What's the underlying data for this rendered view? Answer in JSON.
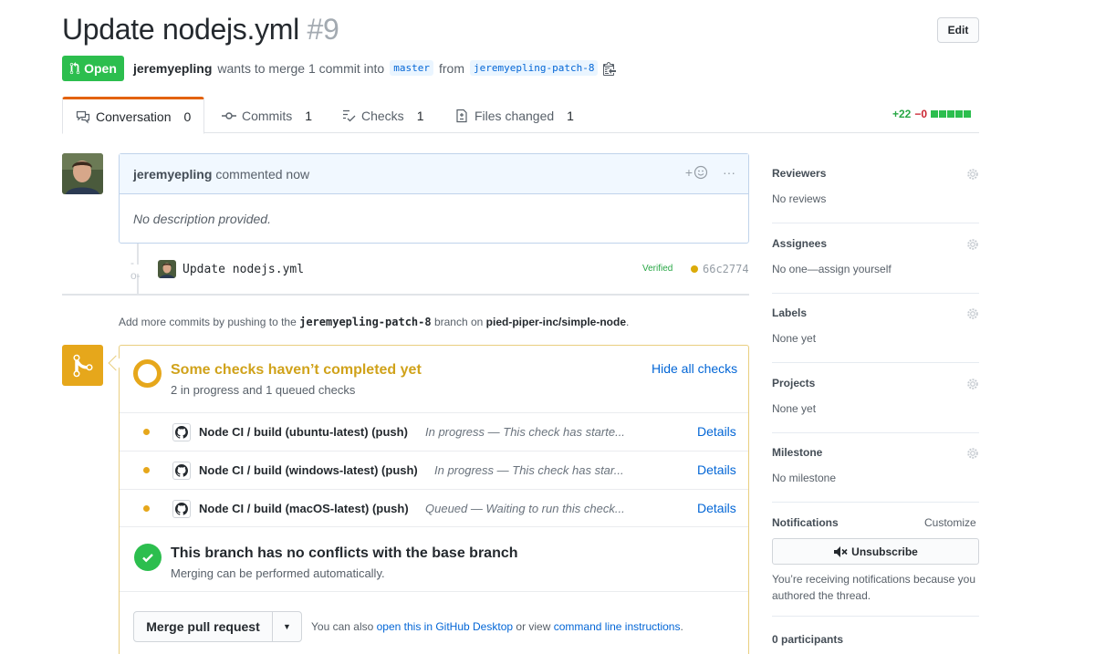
{
  "header": {
    "title": "Update nodejs.yml",
    "number": "#9",
    "edit_label": "Edit",
    "state": "Open",
    "author": "jeremyepling",
    "merge_text": "wants to merge 1 commit into",
    "base_branch": "master",
    "from_text": "from",
    "head_branch": "jeremyepling-patch-8"
  },
  "tabs": [
    {
      "label": "Conversation",
      "count": "0",
      "icon": "comment-discussion-icon"
    },
    {
      "label": "Commits",
      "count": "1",
      "icon": "git-commit-icon"
    },
    {
      "label": "Checks",
      "count": "1",
      "icon": "checklist-icon"
    },
    {
      "label": "Files changed",
      "count": "1",
      "icon": "file-diff-icon"
    }
  ],
  "diffstat": {
    "additions": "+22",
    "deletions": "−0"
  },
  "comment": {
    "author": "jeremyepling",
    "action": "commented now",
    "body": "No description provided.",
    "add_reaction": "+",
    "more": "···"
  },
  "commit": {
    "message": "Update nodejs.yml",
    "verified": "Verified",
    "sha": "66c2774"
  },
  "push_hint": {
    "prefix": "Add more commits by pushing to the",
    "branch": "jeremyepling-patch-8",
    "middle": "branch on",
    "repo": "pied-piper-inc/simple-node",
    "suffix": "."
  },
  "checks": {
    "title": "Some checks haven’t completed yet",
    "subtitle": "2 in progress and 1 queued checks",
    "hide_label": "Hide all checks",
    "status_color": "#e6a71b",
    "items": [
      {
        "name": "Node CI / build (ubuntu-latest) (push)",
        "desc": "In progress — This check has starte...",
        "details": "Details"
      },
      {
        "name": "Node CI / build (windows-latest) (push)",
        "desc": "In progress — This check has star...",
        "details": "Details"
      },
      {
        "name": "Node CI / build (macOS-latest) (push)",
        "desc": "Queued — Waiting to run this check...",
        "details": "Details"
      }
    ]
  },
  "conflicts": {
    "title": "This branch has no conflicts with the base branch",
    "subtitle": "Merging can be performed automatically."
  },
  "merge": {
    "button_label": "Merge pull request",
    "hint_prefix": "You can also",
    "desktop_link": "open this in GitHub Desktop",
    "hint_middle": "or view",
    "cli_link": "command line instructions",
    "hint_suffix": "."
  },
  "sidebar": {
    "sections": [
      {
        "title": "Reviewers",
        "value": "No reviews"
      },
      {
        "title": "Assignees",
        "value": "No one—assign yourself"
      },
      {
        "title": "Labels",
        "value": "None yet"
      },
      {
        "title": "Projects",
        "value": "None yet"
      },
      {
        "title": "Milestone",
        "value": "No milestone"
      }
    ],
    "notifications": {
      "title": "Notifications",
      "customize": "Customize",
      "unsubscribe": "Unsubscribe",
      "reason": "You’re receiving notifications because you authored the thread."
    },
    "participants": "0 participants"
  },
  "colors": {
    "open_green": "#2cbe4e",
    "pending_yellow": "#e6a71b",
    "link_blue": "#0366d6"
  }
}
